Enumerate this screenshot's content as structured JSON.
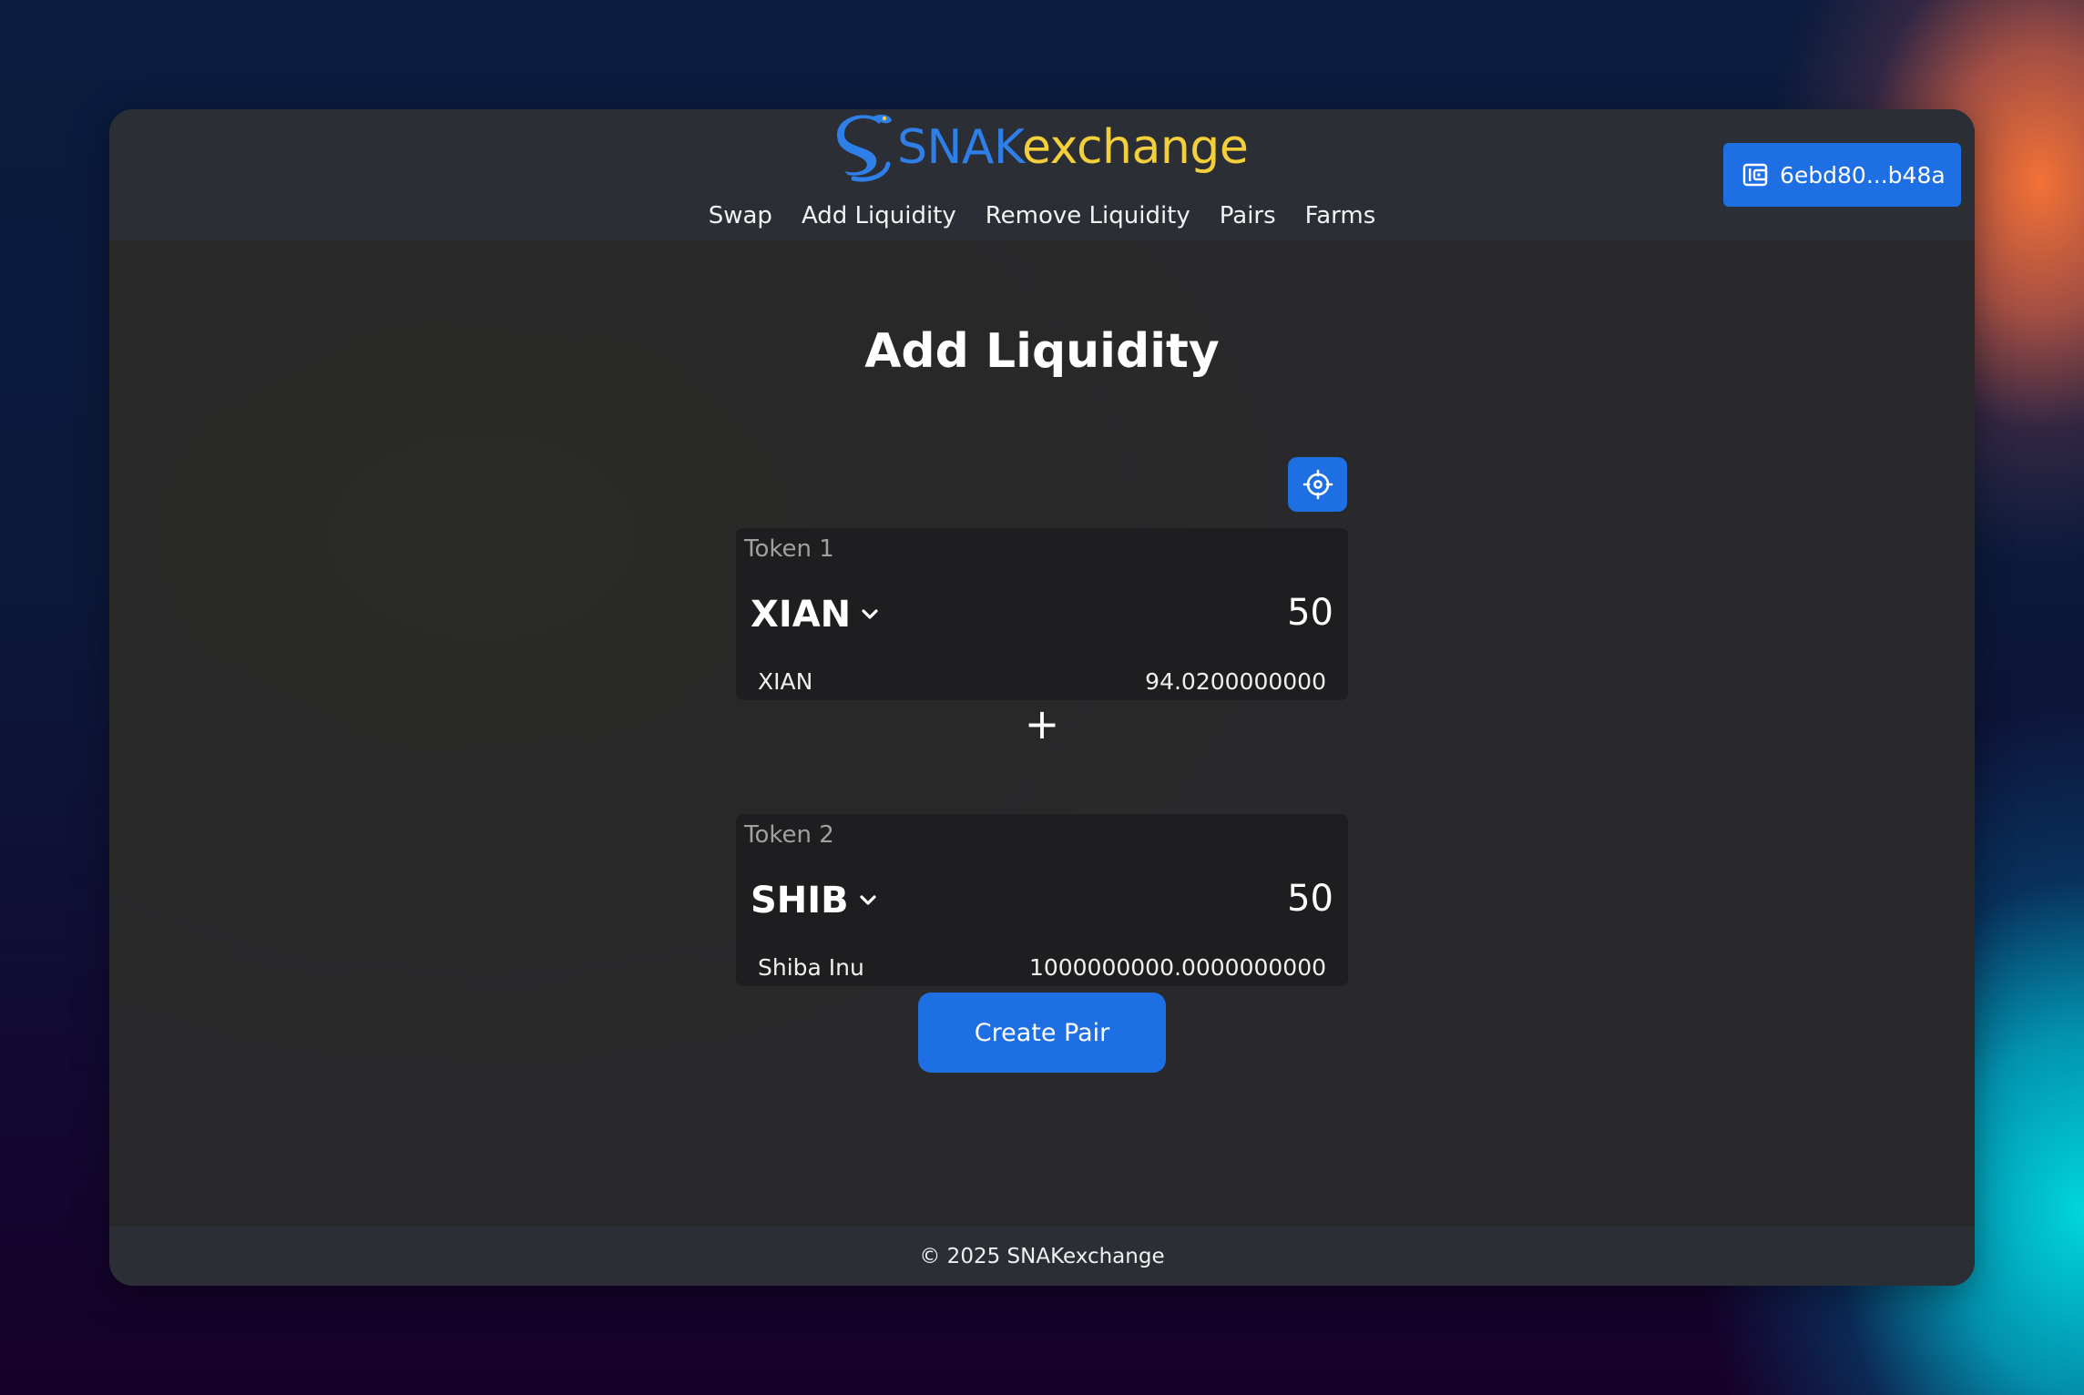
{
  "brand": {
    "name_part1": "SNAK",
    "name_part2": "exchange",
    "primary_color": "#2f7fe8",
    "accent_color": "#f2cf3b"
  },
  "nav": {
    "items": [
      {
        "label": "Swap"
      },
      {
        "label": "Add Liquidity"
      },
      {
        "label": "Remove Liquidity"
      },
      {
        "label": "Pairs"
      },
      {
        "label": "Farms"
      }
    ]
  },
  "wallet": {
    "address": "6ebd80...b48a",
    "icon": "wallet-icon"
  },
  "page": {
    "title": "Add Liquidity"
  },
  "settings": {
    "icon": "gear-icon"
  },
  "token1": {
    "label": "Token 1",
    "symbol": "XIAN",
    "amount": "50",
    "name": "XIAN",
    "balance": "94.0200000000"
  },
  "separator": {
    "symbol": "+"
  },
  "token2": {
    "label": "Token 2",
    "symbol": "SHIB",
    "amount": "50",
    "name": "Shiba Inu",
    "balance": "1000000000.0000000000"
  },
  "actions": {
    "create_pair_label": "Create Pair",
    "button_color": "#1e6fe4"
  },
  "footer": {
    "text": "© 2025 SNAKexchange"
  }
}
